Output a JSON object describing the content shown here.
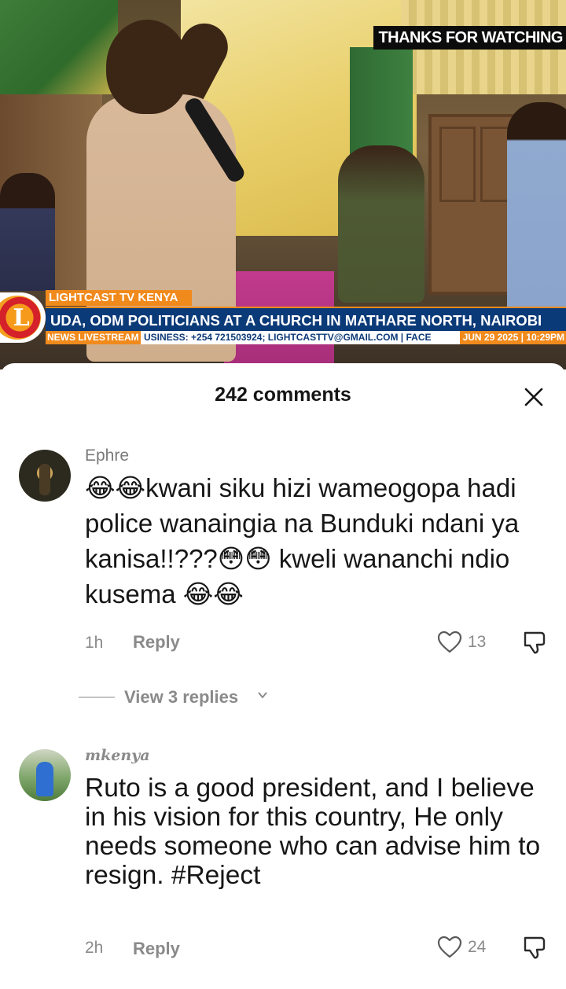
{
  "video": {
    "overlay_text": "THANKS FOR WATCHING",
    "logo_letter": "L",
    "channel": "LIGHTCAST TV KENYA",
    "headline": "UDA, ODM POLITICIANS AT A CHURCH IN MATHARE NORTH, NAIROBI",
    "ticker_tag": "NEWS LIVESTREAM",
    "ticker_text": "USINESS: +254 721503924; LIGHTCASTTV@GMAIL.COM | FACE",
    "ticker_date": "JUN 29 2025 | 10:29PM"
  },
  "sheet": {
    "title": "242 comments",
    "close_icon": "close-icon"
  },
  "comments": [
    {
      "username": "Ephre",
      "text": "😂😂kwani siku hizi wameogopa hadi police wanaingia na Bunduki ndani ya kanisa!!???😳😳 kweli wananchi ndio kusema 😂😂",
      "time": "1h",
      "reply_label": "Reply",
      "likes": "13",
      "view_replies": "View 3 replies"
    },
    {
      "username": "mkenya",
      "text": "Ruto is a good president, and I believe in his vision for this country, He only needs someone who can advise him to resign. #Reject",
      "time": "2h",
      "reply_label": "Reply",
      "likes": "24"
    }
  ],
  "colors": {
    "brand_orange": "#f18a1c",
    "brand_blue": "#0b3a78",
    "meta_gray": "#8a8a8a"
  }
}
